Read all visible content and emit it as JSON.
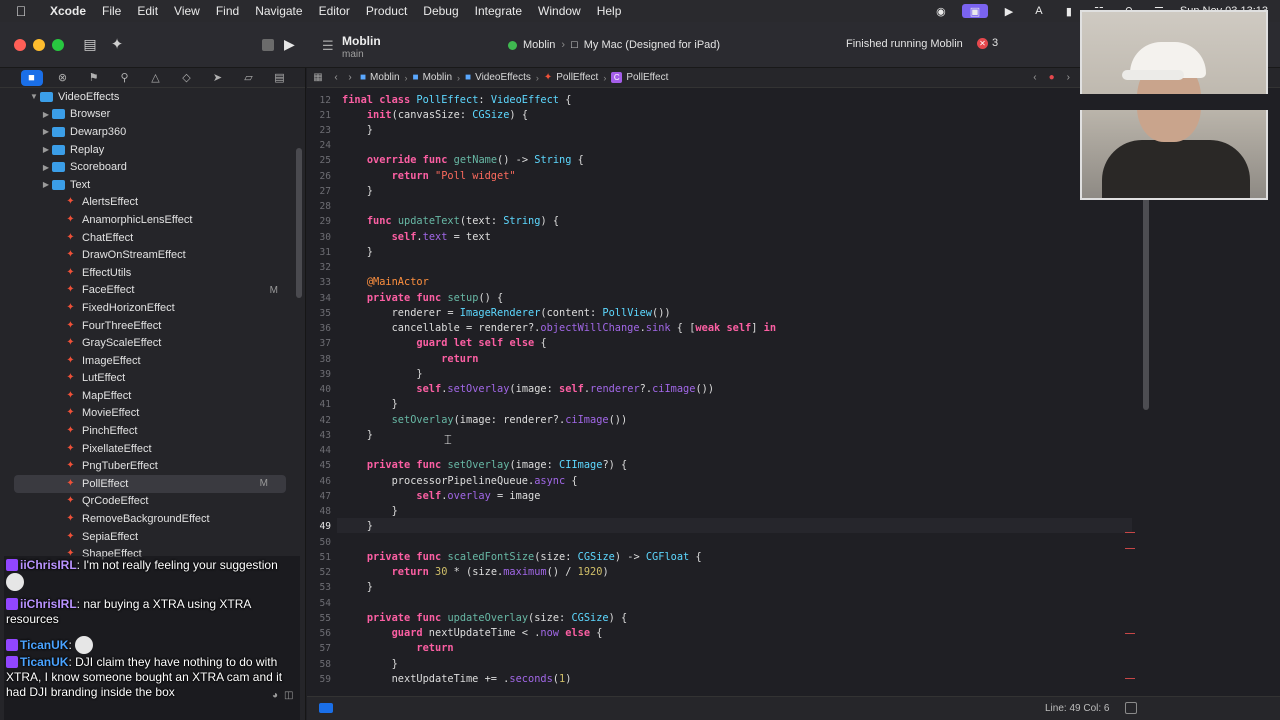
{
  "menubar": {
    "app": "Xcode",
    "items": [
      "File",
      "Edit",
      "View",
      "Find",
      "Navigate",
      "Editor",
      "Product",
      "Debug",
      "Integrate",
      "Window",
      "Help"
    ],
    "clock": "Sun Nov 03 13:13"
  },
  "toolbar": {
    "project_name": "Moblin",
    "branch": "main",
    "scheme": "Moblin",
    "destination": "My Mac (Designed for iPad)",
    "status": "Finished running Moblin",
    "error_count": "3"
  },
  "jumpbar": {
    "path": [
      "Moblin",
      "Moblin",
      "VideoEffects",
      "PollEffect",
      "PollEffect"
    ]
  },
  "navigator": {
    "items": [
      {
        "label": "VideoEffects",
        "kind": "folder",
        "indent": 2,
        "expanded": true
      },
      {
        "label": "Browser",
        "kind": "folder",
        "indent": 3
      },
      {
        "label": "Dewarp360",
        "kind": "folder",
        "indent": 3
      },
      {
        "label": "Replay",
        "kind": "folder",
        "indent": 3
      },
      {
        "label": "Scoreboard",
        "kind": "folder",
        "indent": 3
      },
      {
        "label": "Text",
        "kind": "folder",
        "indent": 3
      },
      {
        "label": "AlertsEffect",
        "kind": "swift",
        "indent": 4
      },
      {
        "label": "AnamorphicLensEffect",
        "kind": "swift",
        "indent": 4
      },
      {
        "label": "ChatEffect",
        "kind": "swift",
        "indent": 4
      },
      {
        "label": "DrawOnStreamEffect",
        "kind": "swift",
        "indent": 4
      },
      {
        "label": "EffectUtils",
        "kind": "swift",
        "indent": 4
      },
      {
        "label": "FaceEffect",
        "kind": "swift",
        "indent": 4,
        "mod": "M"
      },
      {
        "label": "FixedHorizonEffect",
        "kind": "swift",
        "indent": 4
      },
      {
        "label": "FourThreeEffect",
        "kind": "swift",
        "indent": 4
      },
      {
        "label": "GrayScaleEffect",
        "kind": "swift",
        "indent": 4
      },
      {
        "label": "ImageEffect",
        "kind": "swift",
        "indent": 4
      },
      {
        "label": "LutEffect",
        "kind": "swift",
        "indent": 4
      },
      {
        "label": "MapEffect",
        "kind": "swift",
        "indent": 4
      },
      {
        "label": "MovieEffect",
        "kind": "swift",
        "indent": 4
      },
      {
        "label": "PinchEffect",
        "kind": "swift",
        "indent": 4
      },
      {
        "label": "PixellateEffect",
        "kind": "swift",
        "indent": 4
      },
      {
        "label": "PngTuberEffect",
        "kind": "swift",
        "indent": 4
      },
      {
        "label": "PollEffect",
        "kind": "swift",
        "indent": 4,
        "mod": "M",
        "selected": true
      },
      {
        "label": "QrCodeEffect",
        "kind": "swift",
        "indent": 4
      },
      {
        "label": "RemoveBackgroundEffect",
        "kind": "swift",
        "indent": 4
      },
      {
        "label": "SepiaEffect",
        "kind": "swift",
        "indent": 4
      },
      {
        "label": "ShapeEffect",
        "kind": "swift",
        "indent": 4
      }
    ]
  },
  "editor": {
    "sticky_line": {
      "number": "12",
      "html": "<span class=\"kw\">final class</span> <span class=\"ty\">PollEffect</span>: <span class=\"ty\">VideoEffect</span> {"
    },
    "lines": [
      {
        "n": "21",
        "t": "    init(canvasSize: CGSize) {"
      },
      {
        "n": "23",
        "t": "    }"
      },
      {
        "n": "24",
        "t": ""
      },
      {
        "n": "25",
        "t": "    override func getName() -> String {"
      },
      {
        "n": "26",
        "t": "        return \"Poll widget\""
      },
      {
        "n": "27",
        "t": "    }"
      },
      {
        "n": "28",
        "t": ""
      },
      {
        "n": "29",
        "t": "    func updateText(text: String) {"
      },
      {
        "n": "30",
        "t": "        self.text = text"
      },
      {
        "n": "31",
        "t": "    }"
      },
      {
        "n": "32",
        "t": ""
      },
      {
        "n": "33",
        "t": "    @MainActor"
      },
      {
        "n": "34",
        "t": "    private func setup() {"
      },
      {
        "n": "35",
        "t": "        renderer = ImageRenderer(content: PollView())"
      },
      {
        "n": "36",
        "t": "        cancellable = renderer?.objectWillChange.sink { [weak self] in"
      },
      {
        "n": "37",
        "t": "            guard let self else {"
      },
      {
        "n": "38",
        "t": "                return"
      },
      {
        "n": "39",
        "t": "            }"
      },
      {
        "n": "40",
        "t": "            self.setOverlay(image: self.renderer?.ciImage())"
      },
      {
        "n": "41",
        "t": "        }"
      },
      {
        "n": "42",
        "t": "        setOverlay(image: renderer?.ciImage())"
      },
      {
        "n": "43",
        "t": "    }"
      },
      {
        "n": "44",
        "t": ""
      },
      {
        "n": "45",
        "t": "    private func setOverlay(image: CIImage?) {"
      },
      {
        "n": "46",
        "t": "        processorPipelineQueue.async {"
      },
      {
        "n": "47",
        "t": "            self.overlay = image"
      },
      {
        "n": "48",
        "t": "        }"
      },
      {
        "n": "49",
        "t": "    }"
      },
      {
        "n": "50",
        "t": ""
      },
      {
        "n": "51",
        "t": "    private func scaledFontSize(size: CGSize) -> CGFloat {"
      },
      {
        "n": "52",
        "t": "        return 30 * (size.maximum() / 1920)"
      },
      {
        "n": "53",
        "t": "    }"
      },
      {
        "n": "54",
        "t": ""
      },
      {
        "n": "55",
        "t": "    private func updateOverlay(size: CGSize) {"
      },
      {
        "n": "56",
        "t": "        guard nextUpdateTime < .now else {"
      },
      {
        "n": "57",
        "t": "            return"
      },
      {
        "n": "58",
        "t": "        }"
      },
      {
        "n": "59",
        "t": "        nextUpdateTime += .seconds(1)"
      }
    ],
    "current_line": "49"
  },
  "statusbar": {
    "cursor": "Line: 49  Col: 6"
  },
  "chat": {
    "messages": [
      {
        "user": "iiChrisIRL",
        "color": "purple",
        "text": ": I'm not really feeling your suggestion"
      },
      {
        "user": "iiChrisIRL",
        "color": "purple",
        "text": ": nar buying a XTRA using XTRA resources"
      },
      {
        "user": "TicanUK",
        "color": "blue",
        "text": ":"
      },
      {
        "user": "TicanUK",
        "color": "blue",
        "text": ": DJI claim they have nothing to do with XTRA, I know someone bought an XTRA cam and it had DJI branding inside the box"
      }
    ]
  }
}
